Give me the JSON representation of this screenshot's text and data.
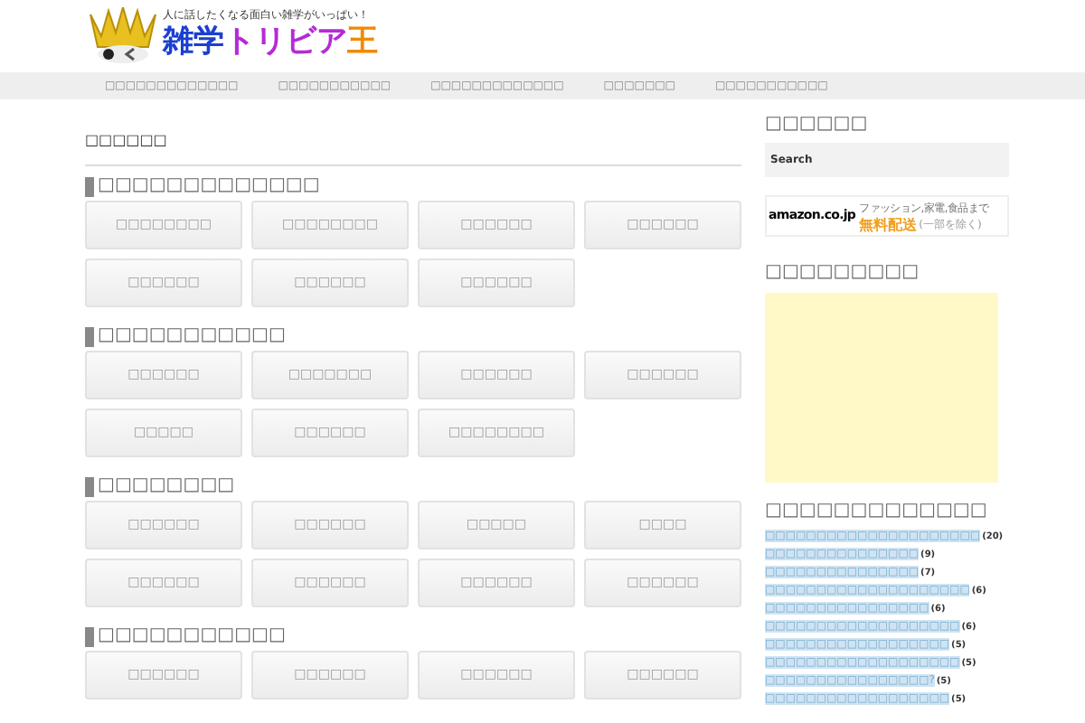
{
  "header": {
    "tagline": "人に話したくなる面白い雑学がいっぱい！",
    "logo_parts": [
      {
        "text": "雑学",
        "color": "#1a3fd1"
      },
      {
        "text": "トリビア",
        "color": "#b52ad6"
      },
      {
        "text": "王",
        "color": "#f08a00"
      }
    ]
  },
  "nav": [
    "□□□□□□□□□□□□□",
    "□□□□□□□□□□□",
    "□□□□□□□□□□□□□",
    "□□□□□□□",
    "□□□□□□□□□□□"
  ],
  "page_title": "□□□□□□",
  "sections": [
    {
      "heading": "□□□□□□□□□□□□□",
      "buttons": [
        "□□□□□□□□",
        "□□□□□□□□",
        "□□□□□□",
        "□□□□□□",
        "□□□□□□",
        "□□□□□□",
        "□□□□□□"
      ]
    },
    {
      "heading": "□□□□□□□□□□□",
      "buttons": [
        "□□□□□□",
        "□□□□□□□",
        "□□□□□□",
        "□□□□□□",
        "□□□□□",
        "□□□□□□",
        "□□□□□□□□"
      ]
    },
    {
      "heading": "□□□□□□□□",
      "buttons": [
        "□□□□□□",
        "□□□□□□",
        "□□□□□",
        "□□□□",
        "□□□□□□",
        "□□□□□□",
        "□□□□□□",
        "□□□□□□"
      ]
    },
    {
      "heading": "□□□□□□□□□□□",
      "buttons": [
        "□□□□□□",
        "□□□□□□",
        "□□□□□□",
        "□□□□□□"
      ]
    }
  ],
  "sidebar": {
    "search_heading": "□□□□□□",
    "search": {
      "placeholder": "Search"
    },
    "ad": {
      "brand": "amazon.co.jp",
      "line1": "ファッション,家電,食品まで",
      "line2": "無料配送",
      "note": "(一部を除く)"
    },
    "ad_heading": "□□□□□□□□□",
    "list_heading": "□□□□□□□□□□□□□",
    "items": [
      {
        "text": "□□□□□□□□□□□□□□□□□□□□□",
        "count": "(20)"
      },
      {
        "text": "□□□□□□□□□□□□□□□",
        "count": "(9)"
      },
      {
        "text": "□□□□□□□□□□□□□□□",
        "count": "(7)"
      },
      {
        "text": "□□□□□□□□□□□□□□□□□□□□",
        "count": "(6)"
      },
      {
        "text": "□□□□□□□□□□□□□□□□",
        "count": "(6)"
      },
      {
        "text": "□□□□□□□□□□□□□□□□□□□",
        "count": "(6)"
      },
      {
        "text": "□□□□□□□□□□□□□□□□□□",
        "count": "(5)"
      },
      {
        "text": "□□□□□□□□□□□□□□□□□□□",
        "count": "(5)"
      },
      {
        "text": "□□□□□□□□□□□□□□□□?",
        "count": "(5)"
      },
      {
        "text": "□□□□□□□□□□□□□□□□□□",
        "count": "(5)"
      }
    ]
  }
}
